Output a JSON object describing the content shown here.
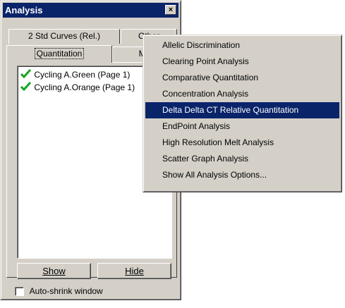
{
  "window": {
    "title": "Analysis",
    "close_symbol": "×"
  },
  "tabs": {
    "row_back": [
      {
        "label": "2 Std Curves (Rel.)"
      },
      {
        "label": "Other"
      }
    ],
    "row_front": [
      {
        "label": "Quantitation"
      },
      {
        "label": "Me"
      }
    ]
  },
  "list": {
    "items": [
      {
        "label": "Cycling A.Green (Page 1)",
        "checked": true
      },
      {
        "label": "Cycling A.Orange (Page 1)",
        "checked": true
      }
    ]
  },
  "buttons": {
    "show": "Show",
    "hide": "Hide"
  },
  "options": {
    "auto_shrink_label": "Auto-shrink window",
    "auto_shrink_checked": false
  },
  "menu": {
    "items": [
      "Allelic Discrimination",
      "Clearing Point Analysis",
      "Comparative Quantitation",
      "Concentration Analysis",
      "Delta Delta CT Relative Quantitation",
      "EndPoint Analysis",
      "High Resolution Melt Analysis",
      "Scatter Graph Analysis",
      "Show All Analysis Options..."
    ],
    "selected_index": 4
  },
  "colors": {
    "titlebar": "#0a246a",
    "check_green": "#17a31f",
    "face": "#d4d0c8"
  }
}
